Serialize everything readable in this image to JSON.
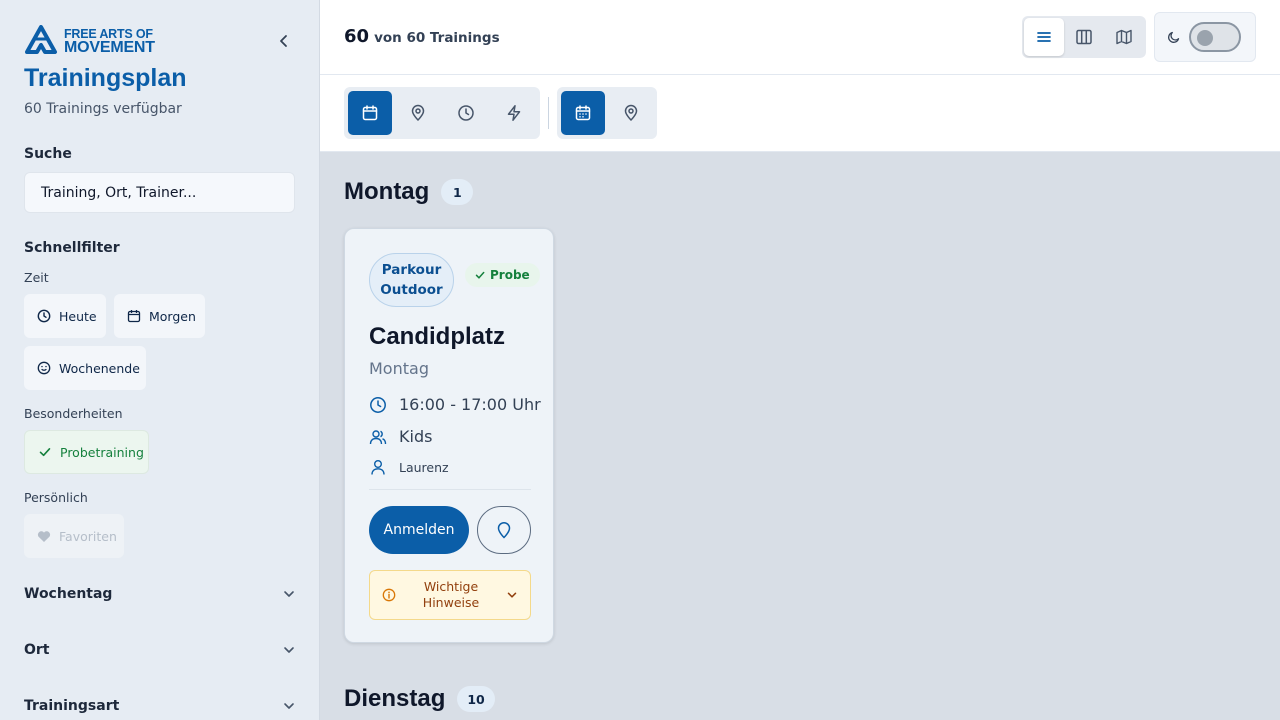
{
  "sidebar": {
    "logo": {
      "line1": "FREE ARTS OF",
      "line2": "MOVEMENT"
    },
    "title": "Trainingsplan",
    "subtitle": "60 Trainings verfügbar",
    "search": {
      "label": "Suche",
      "placeholder": "Training, Ort, Trainer..."
    },
    "quickfilter": {
      "label": "Schnellfilter",
      "time_label": "Zeit",
      "today": "Heute",
      "tomorrow": "Morgen",
      "weekend": "Wochenende",
      "special_label": "Besonderheiten",
      "trial": "Probetraining",
      "personal_label": "Persönlich",
      "favorites": "Favoriten"
    },
    "accordions": {
      "weekday": "Wochentag",
      "location": "Ort",
      "type": "Trainingsart"
    }
  },
  "header": {
    "count": "60",
    "count_text": "von 60 Trainings",
    "view_modes": [
      "list-view",
      "columns-view",
      "map-view"
    ],
    "active_view": "list-view",
    "dark_mode": false
  },
  "toolbar": {
    "group_by": [
      "calendar",
      "location",
      "time",
      "type"
    ],
    "active_group": "calendar",
    "secondary": [
      "calendar",
      "location"
    ],
    "active_secondary": "calendar"
  },
  "days": [
    {
      "name": "Montag",
      "count": "1"
    },
    {
      "name": "Dienstag",
      "count": "10"
    }
  ],
  "card": {
    "tag_line1": "Parkour",
    "tag_line2": "Outdoor",
    "probe": "Probe",
    "title": "Candidplatz",
    "day": "Montag",
    "time": "16:00 - 17:00 Uhr",
    "group": "Kids",
    "trainer": "Laurenz",
    "register": "Anmelden",
    "notes_line1": "Wichtige",
    "notes_line2": "Hinweise"
  },
  "colors": {
    "primary": "#0b5ea8",
    "sidebar_bg": "#e6ecf3",
    "main_bg": "#d8dee6",
    "success": "#15803d",
    "warning_bg": "#fff8e1",
    "warning_text": "#92400e"
  }
}
